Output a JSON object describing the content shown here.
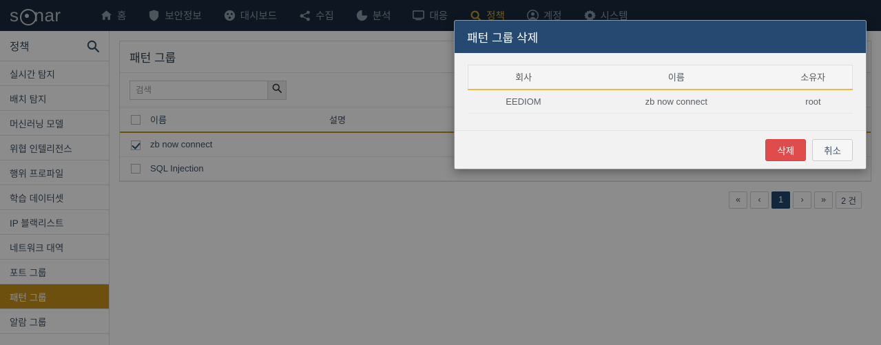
{
  "brand": {
    "name_left": "s",
    "name_right": "nar"
  },
  "topnav": {
    "items": [
      {
        "label": "홈",
        "icon": "home-icon",
        "active": false
      },
      {
        "label": "보안정보",
        "icon": "shield-icon",
        "active": false
      },
      {
        "label": "대시보드",
        "icon": "dashboard-icon",
        "active": false
      },
      {
        "label": "수집",
        "icon": "share-icon",
        "active": false
      },
      {
        "label": "분석",
        "icon": "pie-chart-icon",
        "active": false
      },
      {
        "label": "대응",
        "icon": "monitor-icon",
        "active": false
      },
      {
        "label": "정책",
        "icon": "search-icon",
        "active": true
      },
      {
        "label": "계정",
        "icon": "user-icon",
        "active": false
      },
      {
        "label": "시스템",
        "icon": "gear-icon",
        "active": false
      }
    ]
  },
  "sidebar": {
    "title": "정책",
    "search_icon": "search-icon",
    "items": [
      {
        "label": "실시간 탐지",
        "active": false
      },
      {
        "label": "배치 탐지",
        "active": false
      },
      {
        "label": "머신러닝 모델",
        "active": false
      },
      {
        "label": "위협 인텔리전스",
        "active": false
      },
      {
        "label": "행위 프로파일",
        "active": false
      },
      {
        "label": "학습 데이터셋",
        "active": false
      },
      {
        "label": "IP 블랙리스트",
        "active": false
      },
      {
        "label": "네트워크 대역",
        "active": false
      },
      {
        "label": "포트 그룹",
        "active": false
      },
      {
        "label": "패턴 그룹",
        "active": true
      },
      {
        "label": "알람 그룹",
        "active": false
      }
    ]
  },
  "main": {
    "panel_title": "패턴 그룹",
    "search": {
      "value": "",
      "placeholder": "검색",
      "button_icon": "search-icon"
    },
    "table": {
      "columns": [
        "이름",
        "설명"
      ],
      "rows": [
        {
          "checked": true,
          "name": "zb now connect",
          "desc": ""
        },
        {
          "checked": false,
          "name": "SQL Injection",
          "desc": ""
        }
      ]
    },
    "pagination": {
      "first": "«",
      "prev": "‹",
      "pages": [
        "1"
      ],
      "current": "1",
      "next": "›",
      "last": "»",
      "count_label": "2 건"
    }
  },
  "modal": {
    "title": "패턴 그룹 삭제",
    "table": {
      "columns": [
        "회사",
        "이름",
        "소유자"
      ],
      "rows": [
        {
          "company": "EEDIOM",
          "name": "zb now connect",
          "owner": "root"
        }
      ]
    },
    "confirm_label": "삭제",
    "cancel_label": "취소"
  },
  "colors": {
    "nav_bg": "#1b2a3c",
    "nav_active": "#caa52e",
    "sidebar_active_bg": "#c8921a",
    "modal_header_bg": "#254970",
    "accent_gold": "#f0b840",
    "danger": "#e04b4b",
    "page_active_bg": "#22486e"
  }
}
